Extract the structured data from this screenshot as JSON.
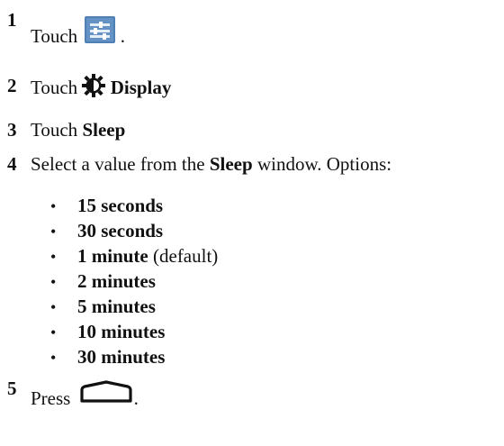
{
  "steps": [
    {
      "number": "1",
      "prefix": "Touch",
      "suffix": "."
    },
    {
      "number": "2",
      "prefix": "Touch",
      "bold": "Display"
    },
    {
      "number": "3",
      "prefix": "Touch",
      "bold": "Sleep"
    },
    {
      "number": "4",
      "prefix": "Select a value from the",
      "bold": "Sleep",
      "suffix": "window. Options:"
    },
    {
      "number": "5",
      "prefix": "Press",
      "suffix": "."
    }
  ],
  "options": [
    {
      "label": "15 seconds",
      "note": ""
    },
    {
      "label": "30 seconds",
      "note": ""
    },
    {
      "label": "1 minute",
      "note": "(default)"
    },
    {
      "label": "2 minutes",
      "note": ""
    },
    {
      "label": "5 minutes",
      "note": ""
    },
    {
      "label": "10 minutes",
      "note": ""
    },
    {
      "label": "30 minutes",
      "note": ""
    }
  ],
  "bullet_char": "•",
  "icons": {
    "step1": "settings-sliders-icon",
    "step2": "brightness-icon",
    "step5": "home-button-icon"
  },
  "colors": {
    "settings_icon_bg": "#4e7fb5",
    "text": "#111111"
  }
}
